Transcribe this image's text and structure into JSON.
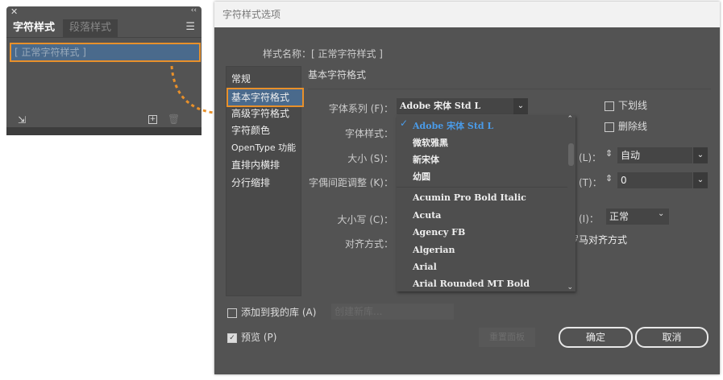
{
  "panel": {
    "tabs": [
      "字符样式",
      "段落样式"
    ],
    "styles": [
      "[ 正常字符样式 ]"
    ]
  },
  "dialog": {
    "title": "字符样式选项",
    "style_name_label": "样式名称：",
    "style_name": "[ 正常字符样式 ]",
    "nav": [
      "常规",
      "基本字符格式",
      "高级字符格式",
      "字符颜色",
      "OpenType 功能",
      "直排内横排",
      "分行缩排"
    ],
    "section_title": "基本字符格式",
    "labels": {
      "font_family": "字体系列 (F)：",
      "font_style": "字体样式：",
      "size": "大小 (S)：",
      "kerning": "字偶间距调整 (K)：",
      "case": "大小写 (C)：",
      "alignment": "对齐方式：",
      "leading": "(L)：",
      "tracking": "(T)：",
      "rotation": "(I)：",
      "roman": "直罗马对齐方式"
    },
    "font_family_value": "Adobe 宋体 Std L",
    "font_list": [
      "Adobe 宋体 Std L",
      "微软雅黑",
      "新宋体",
      "幼圆",
      "Acumin Pro Bold Italic",
      "Acuta",
      "Agency FB",
      "Algerian",
      "Arial",
      "Arial Rounded MT Bold"
    ],
    "underline": "下划线",
    "strikethrough": "删除线",
    "leading_value": "自动",
    "tracking_value": "0",
    "rotation_value": "正常",
    "add_library": "添加到我的库 (A)",
    "library_select": "创建新库...",
    "preview": "预览 (P)",
    "reset": "重置面板",
    "ok": "确定",
    "cancel": "取消"
  },
  "colors": {
    "accent": "#e8902a",
    "selected": "#4a6a8c",
    "link": "#4a9be8"
  }
}
